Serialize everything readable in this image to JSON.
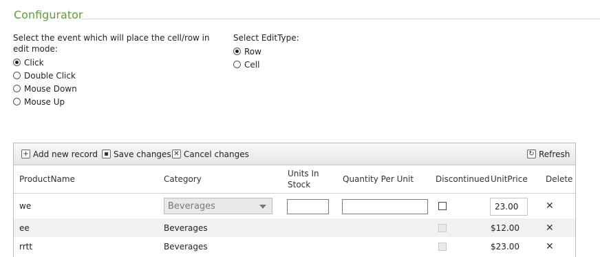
{
  "configurator": {
    "title": "Configurator",
    "event_label": "Select the event which will place the cell/row in edit mode:",
    "event_options": [
      {
        "label": "Click",
        "checked": true
      },
      {
        "label": "Double Click",
        "checked": false
      },
      {
        "label": "Mouse Down",
        "checked": false
      },
      {
        "label": "Mouse Up",
        "checked": false
      }
    ],
    "edit_type_label": "Select EditType:",
    "edit_type_options": [
      {
        "label": "Row",
        "checked": true
      },
      {
        "label": "Cell",
        "checked": false
      }
    ]
  },
  "toolbar": {
    "add_label": "Add new record",
    "save_label": "Save changes",
    "cancel_label": "Cancel changes",
    "refresh_label": "Refresh"
  },
  "grid": {
    "headers": {
      "product_name": "ProductName",
      "category": "Category",
      "units_in_stock_1": "Units In",
      "units_in_stock_2": "Stock",
      "quantity_per_unit": "Quantity Per Unit",
      "discontinued": "Discontinued",
      "unit_price": "UnitPrice",
      "delete": "Delete"
    },
    "edit_row": {
      "product_name": "we",
      "category": "Beverages",
      "unit_price": "23.00"
    },
    "rows": [
      {
        "product_name": "ee",
        "category": "Beverages",
        "unit_price": "$12.00"
      },
      {
        "product_name": "rrtt",
        "category": "Beverages",
        "unit_price": "$23.00"
      }
    ]
  }
}
